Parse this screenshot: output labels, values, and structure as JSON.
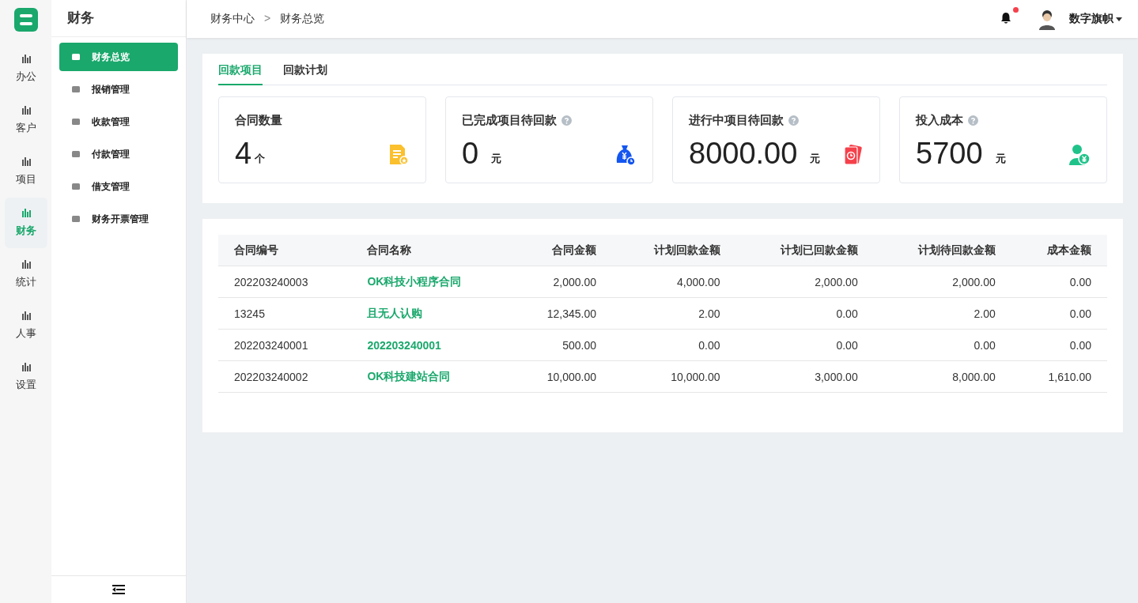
{
  "rail": [
    {
      "label": "办公",
      "selected": false
    },
    {
      "label": "客户",
      "selected": false
    },
    {
      "label": "项目",
      "selected": false
    },
    {
      "label": "财务",
      "selected": true
    },
    {
      "label": "统计",
      "selected": false
    },
    {
      "label": "人事",
      "selected": false
    },
    {
      "label": "设置",
      "selected": false
    }
  ],
  "menu": {
    "title": "财务",
    "items": [
      {
        "label": "财务总览",
        "selected": true
      },
      {
        "label": "报销管理",
        "selected": false
      },
      {
        "label": "收款管理",
        "selected": false
      },
      {
        "label": "付款管理",
        "selected": false
      },
      {
        "label": "借支管理",
        "selected": false
      },
      {
        "label": "财务开票管理",
        "selected": false
      }
    ]
  },
  "breadcrumb": [
    "财务中心",
    "财务总览"
  ],
  "breadcrumb_separator": ">",
  "user": {
    "name": "数字旗帜",
    "unread": true
  },
  "tabs": [
    {
      "label": "回款项目",
      "selected": true
    },
    {
      "label": "回款计划",
      "selected": false
    }
  ],
  "stats": [
    {
      "title": "合同数量",
      "value": "4",
      "unit": "个",
      "help": false,
      "kind": "document",
      "color": "#fbc02d"
    },
    {
      "title": "已完成项目待回款",
      "value": "0",
      "unit": "元",
      "help": true,
      "kind": "moneybag",
      "color": "#1456f0"
    },
    {
      "title": "进行中项目待回款",
      "value": "8000.00",
      "unit": "元",
      "help": true,
      "kind": "cards",
      "color": "#f5414b"
    },
    {
      "title": "投入成本",
      "value": "5700",
      "unit": "元",
      "help": true,
      "kind": "person",
      "color": "#1fc38a"
    }
  ],
  "table": {
    "columns": [
      "合同编号",
      "合同名称",
      "合同金额",
      "计划回款金额",
      "计划已回款金额",
      "计划待回款金额",
      "成本金额"
    ],
    "rows": [
      [
        "202203240003",
        "OK科技小程序合同",
        "2,000.00",
        "4,000.00",
        "2,000.00",
        "2,000.00",
        "0.00"
      ],
      [
        "13245",
        "且无人认购",
        "12,345.00",
        "2.00",
        "0.00",
        "2.00",
        "0.00"
      ],
      [
        "202203240001",
        "202203240001",
        "500.00",
        "0.00",
        "0.00",
        "0.00",
        "0.00"
      ],
      [
        "202203240002",
        "OK科技建站合同",
        "10,000.00",
        "10,000.00",
        "3,000.00",
        "8,000.00",
        "1,610.00"
      ]
    ]
  }
}
